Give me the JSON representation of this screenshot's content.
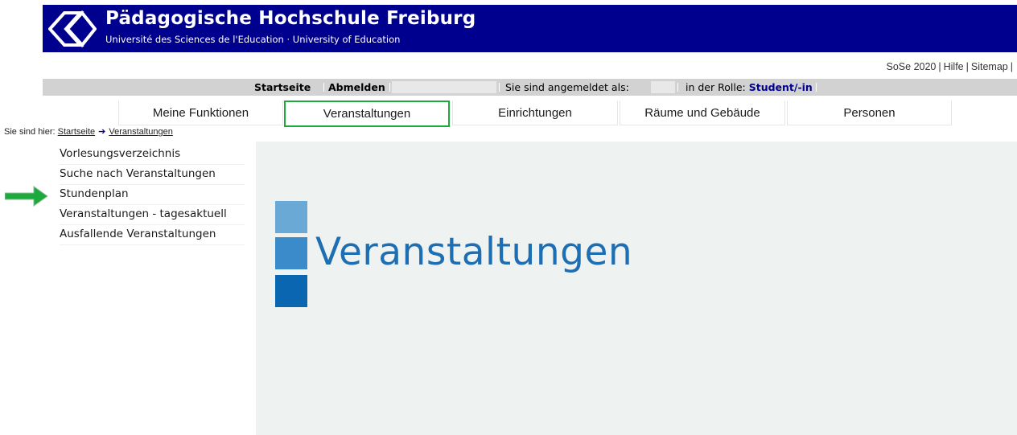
{
  "header": {
    "title": "Pädagogische Hochschule Freiburg",
    "subtitle": "Université des Sciences de l'Education · University of Education"
  },
  "toplinks": {
    "semester": "SoSe 2020",
    "help": "Hilfe",
    "sitemap": "Sitemap"
  },
  "statusbar": {
    "home": "Startseite",
    "logout": "Abmelden",
    "logged_in_label": "Sie sind angemeldet als:",
    "role_label": "in der Rolle:",
    "role": "Student/-in"
  },
  "tabs": [
    {
      "label": "Meine Funktionen"
    },
    {
      "label": "Veranstaltungen"
    },
    {
      "label": "Einrichtungen"
    },
    {
      "label": "Räume und Gebäude"
    },
    {
      "label": "Personen"
    }
  ],
  "active_tab": "Veranstaltungen",
  "breadcrumb": {
    "prefix": "Sie sind hier:",
    "items": [
      "Startseite",
      "Veranstaltungen"
    ]
  },
  "menu": [
    {
      "label": "Vorlesungsverzeichnis"
    },
    {
      "label": "Suche nach Veranstaltungen"
    },
    {
      "label": "Stundenplan"
    },
    {
      "label": "Veranstaltungen - tagesaktuell"
    },
    {
      "label": "Ausfallende Veranstaltungen"
    }
  ],
  "content": {
    "heading": "Veranstaltungen"
  },
  "colors": {
    "brand_navy": "#00008f",
    "active_tab_border": "#1daa3c",
    "heading_blue": "#1e6eb4",
    "square_light": "#6aa8d6",
    "square_mid": "#3b8ac9",
    "square_dark": "#0a66b0",
    "arrow_green": "#1daa3c"
  }
}
